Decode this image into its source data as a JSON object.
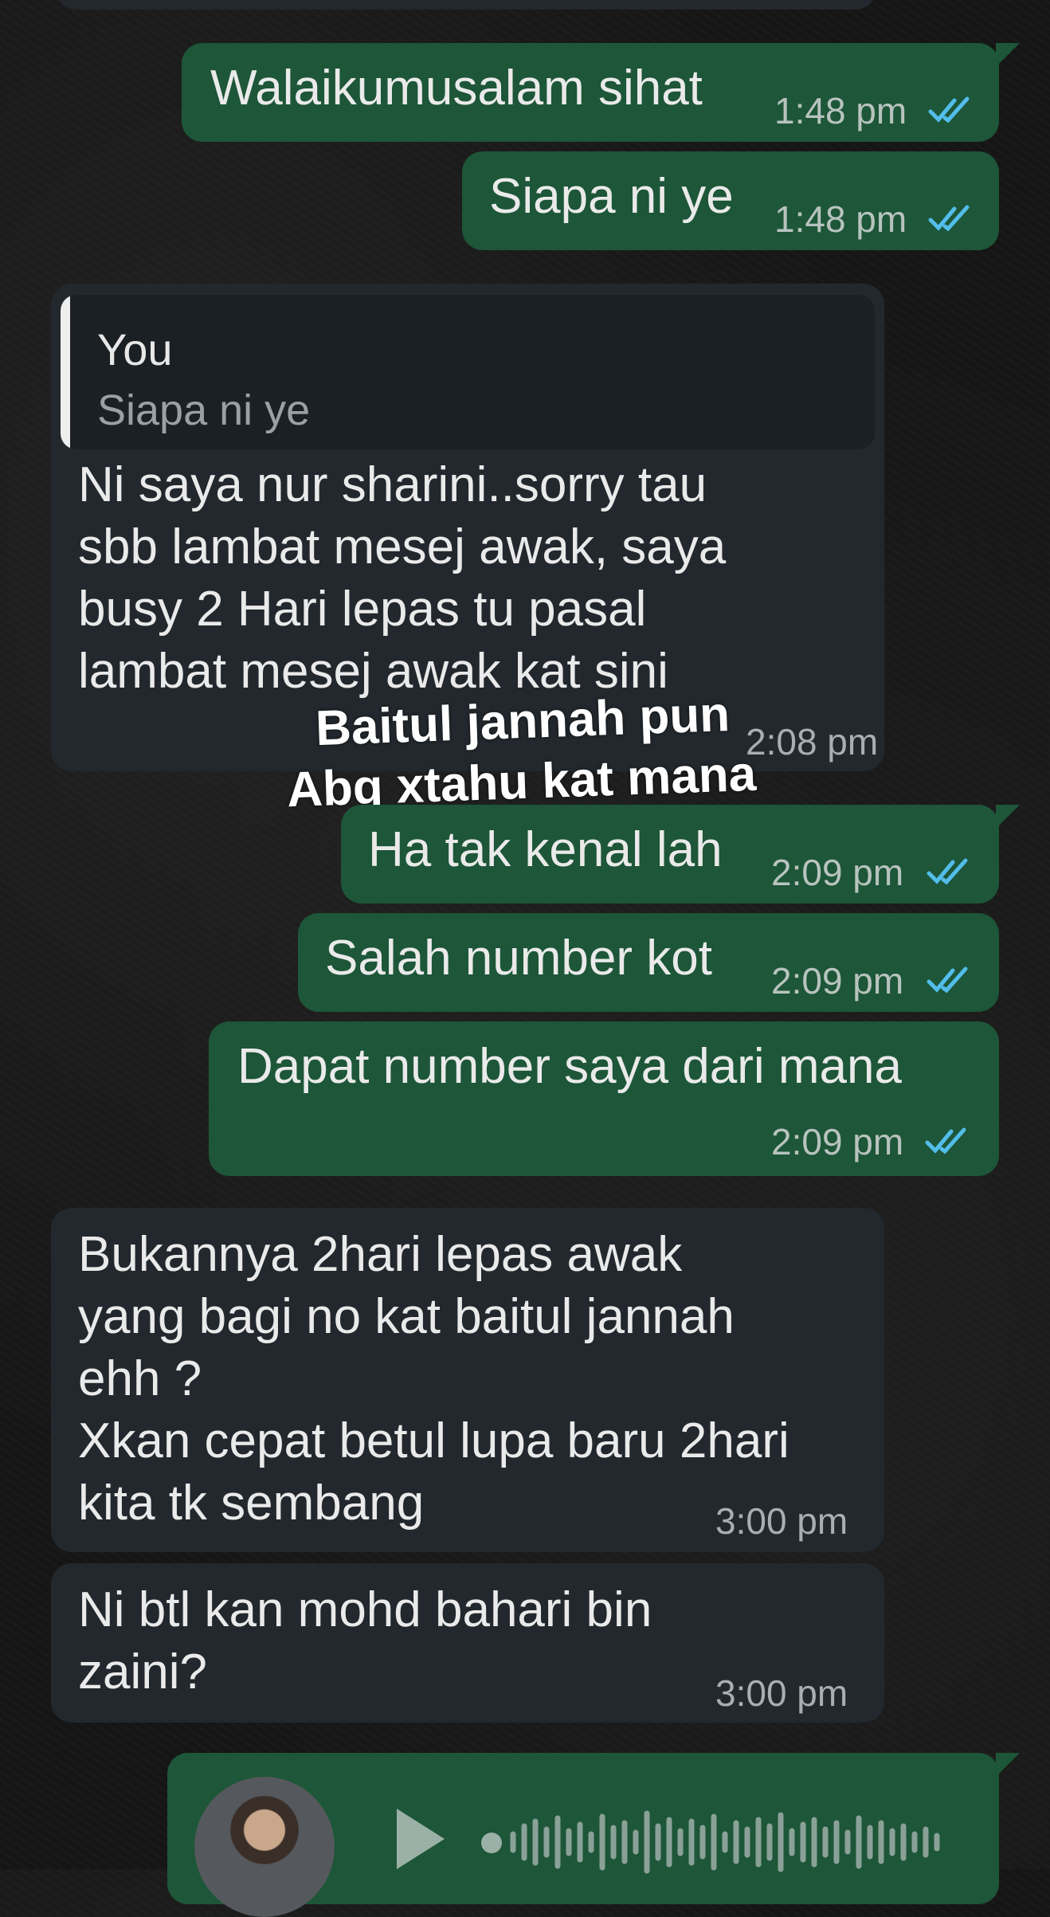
{
  "messages": [
    {
      "text": "Walaikumusalam sihat",
      "time": "1:48 pm"
    },
    {
      "text": "Siapa ni ye",
      "time": "1:48 pm"
    },
    {
      "quote_author": "You",
      "quote_text": "Siapa ni ye",
      "text": "Ni saya nur sharini..sorry tau\nsbb lambat mesej awak, saya\nbusy 2 Hari lepas tu pasal\nlambat mesej awak kat sini",
      "time": "2:08 pm"
    },
    {
      "text": "Ha tak kenal lah",
      "time": "2:09 pm"
    },
    {
      "text": "Salah number kot",
      "time": "2:09 pm"
    },
    {
      "text": "Dapat number saya dari mana",
      "time": "2:09 pm"
    },
    {
      "text": "Bukannya 2hari lepas awak\nyang bagi no kat baitul jannah\nehh ?\nXkan cepat betul lupa baru 2hari\nkita tk sembang",
      "time": "3:00 pm"
    },
    {
      "text": "Ni btl kan mohd bahari bin\nzaini?",
      "time": "3:00 pm"
    }
  ],
  "overlay_text": [
    "Baitul jannah pun",
    "Abg xtahu kat mana"
  ],
  "colors": {
    "outgoing": "#1d5638",
    "incoming": "#22282d",
    "read_tick": "#53bdeb"
  },
  "icons": [
    "double-check-icon",
    "play-icon",
    "avatar"
  ]
}
